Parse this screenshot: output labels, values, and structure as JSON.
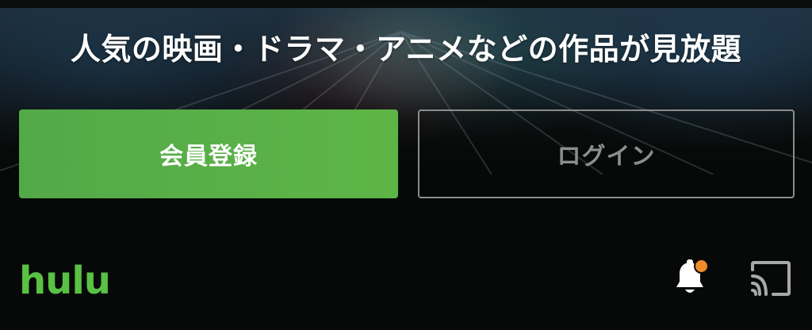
{
  "hero": {
    "headline": "人気の映画・ドラマ・アニメなどの作品が見放題"
  },
  "actions": {
    "signup_label": "会員登録",
    "login_label": "ログイン"
  },
  "header": {
    "logo_text": "hulu",
    "notification_icon": "bell-icon",
    "notification_badge_color": "#f08a2b",
    "cast_icon": "cast-icon"
  },
  "colors": {
    "brand_green": "#5eb547",
    "signup_button": "#56ad48",
    "login_border": "#8a8d8a",
    "background": "#070908"
  }
}
